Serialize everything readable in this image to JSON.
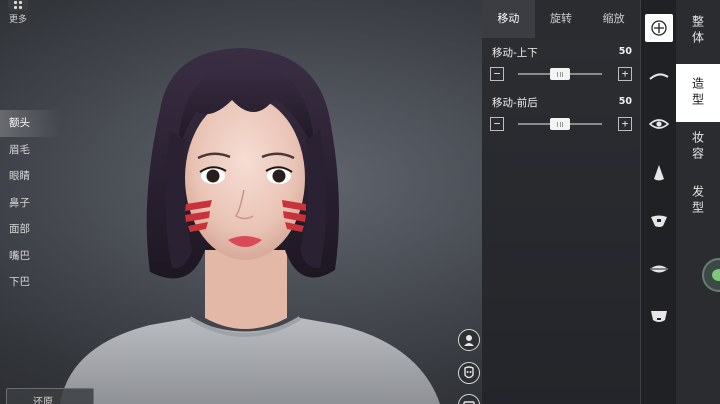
{
  "more": {
    "label": "更多"
  },
  "feature_menu": {
    "items": [
      {
        "label": "额头",
        "active": true
      },
      {
        "label": "眉毛",
        "active": false
      },
      {
        "label": "眼睛",
        "active": false
      },
      {
        "label": "鼻子",
        "active": false
      },
      {
        "label": "面部",
        "active": false
      },
      {
        "label": "嘴巴",
        "active": false
      },
      {
        "label": "下巴",
        "active": false
      }
    ]
  },
  "bottom_left": {
    "label": "还原"
  },
  "panel": {
    "tabs": [
      {
        "label": "移动",
        "active": true
      },
      {
        "label": "旋转",
        "active": false
      },
      {
        "label": "缩放",
        "active": false
      }
    ],
    "sliders": [
      {
        "label": "移动-上下",
        "value": "50",
        "fraction": 0.5
      },
      {
        "label": "移动-前后",
        "value": "50",
        "fraction": 0.5
      }
    ],
    "minus_symbol": "−",
    "plus_symbol": "+"
  },
  "feature_icons": [
    {
      "name": "head-move-icon",
      "active": true
    },
    {
      "name": "eyebrow-icon",
      "active": false
    },
    {
      "name": "eye-icon",
      "active": false
    },
    {
      "name": "nose-icon",
      "active": false
    },
    {
      "name": "face-icon",
      "active": false
    },
    {
      "name": "mouth-icon",
      "active": false
    },
    {
      "name": "chin-icon",
      "active": false
    }
  ],
  "categories": [
    {
      "label": "整体",
      "active": false
    },
    {
      "label": "造型",
      "active": true
    },
    {
      "label": "妆容",
      "active": false
    },
    {
      "label": "发型",
      "active": false
    }
  ],
  "colors": {
    "panel_bg": "#2c2e32",
    "active_tab": "#3b3d42",
    "accent_white": "#ffffff",
    "face_paint_red": "#c8323a",
    "hair": "#2a2232"
  }
}
